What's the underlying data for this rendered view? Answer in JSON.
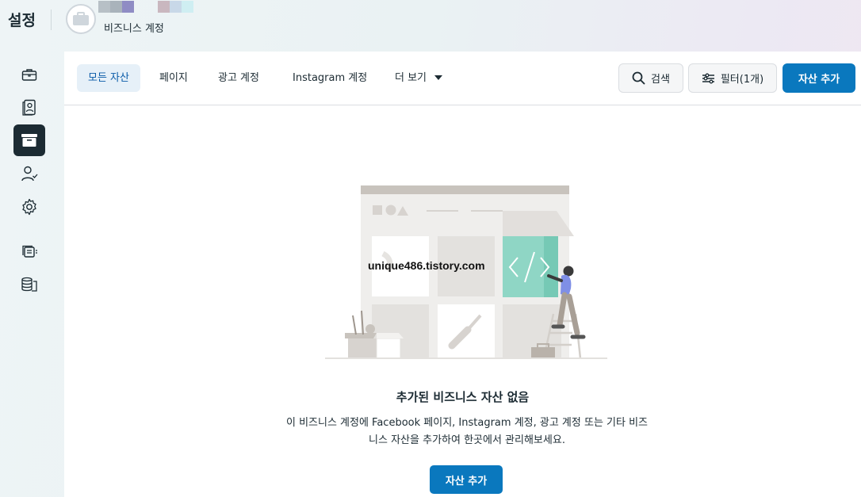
{
  "header": {
    "title": "설정",
    "account_name": "비즈니스 계정",
    "swatch_colors": [
      "#b7c0c6",
      "#a9b3bb",
      "#8f8cc4",
      "#ffffff",
      "#ffffff",
      "#c9b7bf",
      "#c8d8e8",
      "#cfeef2"
    ]
  },
  "rail": {
    "items": [
      {
        "icon": "briefcase-icon",
        "active": false
      },
      {
        "icon": "user-card-icon",
        "active": false
      },
      {
        "icon": "archive-icon",
        "active": true
      },
      {
        "icon": "person-check-icon",
        "active": false
      },
      {
        "icon": "gear-icon",
        "active": false
      },
      {
        "icon": "stacked-pages-icon",
        "active": false
      },
      {
        "icon": "database-icon",
        "active": false
      }
    ]
  },
  "tabs": [
    {
      "label": "모든 자산",
      "active": true
    },
    {
      "label": "페이지",
      "active": false
    },
    {
      "label": "광고 계정",
      "active": false
    },
    {
      "label": "Instagram 계정",
      "active": false
    },
    {
      "label": "더 보기",
      "active": false
    }
  ],
  "actions": {
    "search_label": "검색",
    "filter_label": "필터(1개)",
    "add_asset_label": "자산 추가"
  },
  "empty_state": {
    "watermark": "unique486.tistory.com",
    "title": "추가된 비즈니스 자산 없음",
    "description_line1": "이 비즈니스 계정에 Facebook 페이지, Instagram 계정, 광고 계정 또는 기타 비즈",
    "description_line2": "니스 자산을 추가하여 한곳에서 관리해보세요.",
    "cta_label": "자산 추가"
  },
  "colors": {
    "primary": "#0a78be",
    "active_tab_bg": "#e6f0f8",
    "rail_active": "#1c2b33",
    "accent_teal": "#8fd6c5"
  }
}
